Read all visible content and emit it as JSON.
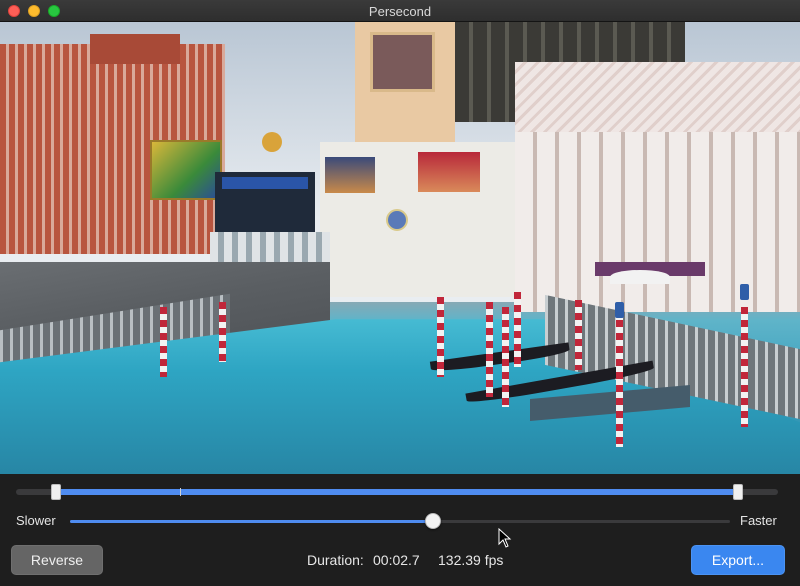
{
  "window": {
    "title": "Persecond"
  },
  "video": {
    "description_icon": "video-frame"
  },
  "trim": {
    "start_fraction": 0.05,
    "end_fraction": 0.945,
    "playhead_fraction": 0.215
  },
  "speed": {
    "slower_label": "Slower",
    "faster_label": "Faster",
    "value_fraction": 0.55
  },
  "buttons": {
    "reverse_label": "Reverse",
    "export_label": "Export..."
  },
  "info": {
    "duration_label": "Duration:",
    "duration_value": "00:02.7",
    "fps_value": "132.39 fps"
  },
  "colors": {
    "accent": "#4f8cf0",
    "export_button": "#3a87f0",
    "reverse_button": "#656565",
    "background": "#1e1e1e"
  }
}
